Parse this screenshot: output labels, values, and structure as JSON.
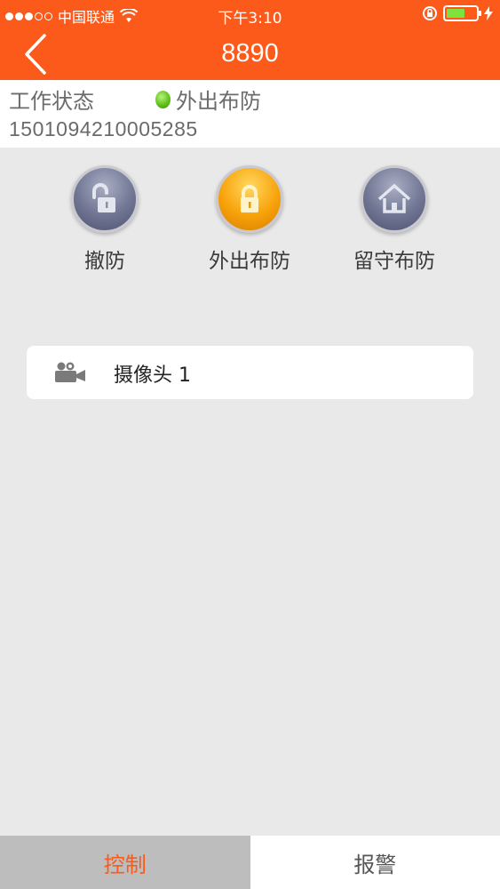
{
  "status_bar": {
    "carrier": "中国联通",
    "time": "下午3:10"
  },
  "nav": {
    "title": "8890"
  },
  "info": {
    "work_status_label": "工作状态",
    "work_status_value": "外出布防",
    "device_id": "1501094210005285"
  },
  "modes": [
    {
      "label": "撤防",
      "icon": "unlock-icon",
      "active": false
    },
    {
      "label": "外出布防",
      "icon": "lock-icon",
      "active": true
    },
    {
      "label": "留守布防",
      "icon": "home-icon",
      "active": false
    }
  ],
  "camera": {
    "label": "摄像头 1",
    "icon": "camera-icon"
  },
  "tabs": [
    {
      "label": "控制",
      "active": true
    },
    {
      "label": "报警",
      "active": false
    }
  ],
  "colors": {
    "accent": "#fb5a1b",
    "status_dot": "#5fc219"
  }
}
